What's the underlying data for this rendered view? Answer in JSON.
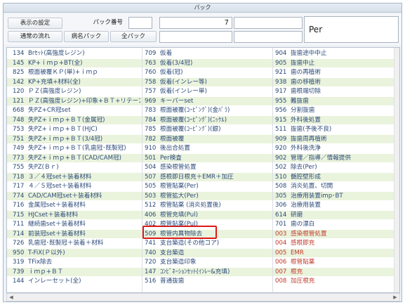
{
  "window": {
    "title": "パック"
  },
  "toolbar": {
    "display_settings": "表示の設定",
    "pack_number_label": "パック番号",
    "pack_number_value": "",
    "normal_flow": "通常の流れ",
    "pack_by_disease": "病名パック",
    "all_packs": "全パック",
    "field_a": "",
    "field_b": "7",
    "field_c": "",
    "field_d": "",
    "field_e": "",
    "per_label": "Per"
  },
  "columns": [
    {
      "rows": [
        [
          "134",
          "Brｾｯﾄ(高強度レジン)"
        ],
        [
          "145",
          "KP+ｉｍｐ+BT(全)"
        ],
        [
          "825",
          "根面被覆ＫＰ(単)+ｉｍｐ"
        ],
        [
          "142",
          "KP+充填+材料(全)"
        ],
        [
          "120",
          "ＰＺ(高強度レジン)"
        ],
        [
          "121",
          "ＰＺ(高強度レジン)+印象+ＢＴ+リテーﾌ"
        ],
        [
          "668",
          "失PZ+CR冠set"
        ],
        [
          "748",
          "失PZ+ｉｍｐ+ＢＴ(金属冠)"
        ],
        [
          "753",
          "失PZ+ｉｍｐ+ＢＴ(HJC)"
        ],
        [
          "751",
          "失PZ+ｉｍｐ+ＢＴ(3/4冠)"
        ],
        [
          "749",
          "失PZ+ｉｍｐ+ＢＴ(乳歯冠･既製冠)"
        ],
        [
          "773",
          "失PZ+ｉｍｐ+ＢＴ(CAD/CAM冠)"
        ],
        [
          "755",
          "失PZ(Ｂｒ)"
        ],
        [
          "718",
          "３／４冠set＋装着材料"
        ],
        [
          "717",
          "４／５冠set＋装着材料"
        ],
        [
          "774",
          "CAD/CAM冠set＋装着材料"
        ],
        [
          "716",
          "金属冠set＋装着材料"
        ],
        [
          "715",
          "HJCset＋装着材料"
        ],
        [
          "711",
          "継続歯set＋装着材料"
        ],
        [
          "714",
          "前装冠set＋装着材料"
        ],
        [
          "726",
          "乳歯冠･既製冠＋装着＋材料"
        ],
        [
          "950",
          "T-FiX(Ｐ以外)"
        ],
        [
          "319",
          "TFix除去"
        ],
        [
          "739",
          "ｉｍｐ+ＢＴ"
        ],
        [
          "144",
          "インレーセット(全)"
        ]
      ]
    },
    {
      "rows": [
        [
          "709",
          "仮着"
        ],
        [
          "763",
          "仮着(3/4冠)"
        ],
        [
          "760",
          "仮着(冠)"
        ],
        [
          "758",
          "仮着(インレー等)"
        ],
        [
          "757",
          "仮着(インレー単)"
        ],
        [
          "969",
          "キーパーset"
        ],
        [
          "783",
          "根面被覆(ｺｰﾋﾟﾝｸﾞ)(金ﾊﾟﾗ)"
        ],
        [
          "784",
          "根面被覆(ｺｰﾋﾟﾝｸﾞ)(ﾆｯｹﾙ)"
        ],
        [
          "785",
          "根面被覆(ｺｰﾋﾟﾝｸﾞ)(銀)"
        ],
        [
          "782",
          "根面被覆"
        ],
        [
          "910",
          "後出合処置"
        ],
        [
          "501",
          "Per検査"
        ],
        [
          "504",
          "感染根管処置"
        ],
        [
          "507",
          "感根即日根充＋EMR＋加圧"
        ],
        [
          "505",
          "根管貼薬(Per)"
        ],
        [
          "503",
          "根管拡大(Per)"
        ],
        [
          "512",
          "根管貼薬 (消炎処置後)"
        ],
        [
          "406",
          "根管充填(Pul)"
        ],
        [
          "402",
          "根管貼薬(Pul)"
        ],
        [
          "509",
          "根管内異物除去"
        ],
        [
          "741",
          "支台築造(その他コア)"
        ],
        [
          "740",
          "支台築造"
        ],
        [
          "720",
          "支台築造印象"
        ],
        [
          "147",
          "ｺﾝﾋﾞﾈｰｼｮﾝｾｯﾄ(ｲﾝﾚｰ&充填)"
        ],
        [
          "516",
          "普通抜歯"
        ]
      ]
    },
    {
      "rows": [
        [
          "904",
          "抜歯途中中止"
        ],
        [
          "905",
          "抜歯中止"
        ],
        [
          "921",
          "歯の再植術"
        ],
        [
          "938",
          "歯の移植術"
        ],
        [
          "917",
          "歯根端切除"
        ],
        [
          "955",
          "難抜歯"
        ],
        [
          "956",
          "分割抜歯"
        ],
        [
          "915",
          "外科後処置"
        ],
        [
          "511",
          "抜歯(予後不良)"
        ],
        [
          "909",
          "抜歯周再植術"
        ],
        [
          "920",
          "外科後洗浄"
        ],
        [
          "902",
          "管理／指導／情報提供"
        ],
        [
          "502",
          "除去(Per)"
        ],
        [
          "510",
          "髄腔壁形成"
        ],
        [
          "508",
          "消炎処置、切開"
        ],
        [
          "305",
          "治療用装置imp･BT"
        ],
        [
          "306",
          "治療用装置"
        ],
        [
          "614",
          "研磨"
        ],
        [
          "701",
          "歯の漂白"
        ],
        [
          "003",
          "感染根管処置"
        ],
        [
          "004",
          "感根即充"
        ],
        [
          "005",
          "EMR"
        ],
        [
          "006",
          "根管貼薬"
        ],
        [
          "007",
          "根充"
        ],
        [
          "008",
          "加圧根充"
        ]
      ]
    }
  ],
  "colors": {
    "highlight": "#e01818",
    "row_alt": "#eaf3dc",
    "text": "#2b4a7a",
    "special_code": "#c0392b"
  }
}
